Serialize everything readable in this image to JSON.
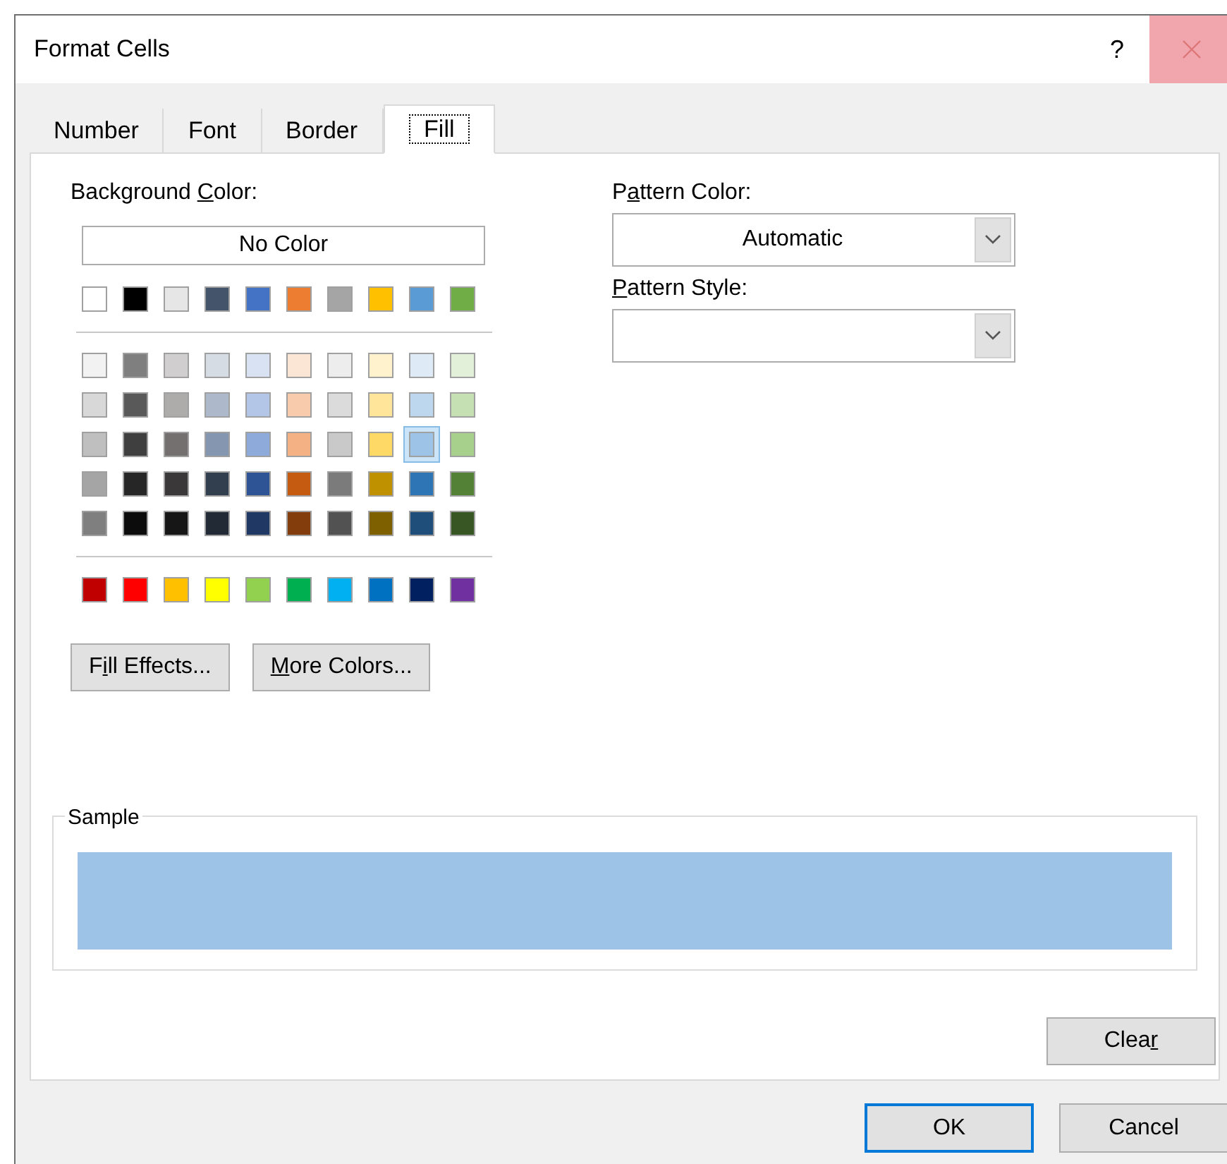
{
  "window": {
    "title": "Format Cells",
    "help": "?"
  },
  "tabs": [
    {
      "label": "Number",
      "selected": false
    },
    {
      "label": "Font",
      "selected": false
    },
    {
      "label": "Border",
      "selected": false
    },
    {
      "label": "Fill",
      "selected": true
    }
  ],
  "background_color": {
    "label": {
      "before": "Background ",
      "key": "C",
      "after": "olor:"
    },
    "no_color_button": "No Color",
    "theme_row": [
      {
        "color": "#ffffff",
        "selected": false
      },
      {
        "color": "#000000",
        "selected": false
      },
      {
        "color": "#e7e6e6",
        "selected": false
      },
      {
        "color": "#44546a",
        "selected": false
      },
      {
        "color": "#4472c4",
        "selected": false
      },
      {
        "color": "#ed7d31",
        "selected": false
      },
      {
        "color": "#a5a5a5",
        "selected": false
      },
      {
        "color": "#ffc000",
        "selected": false
      },
      {
        "color": "#5b9bd5",
        "selected": false
      },
      {
        "color": "#70ad47",
        "selected": false
      }
    ],
    "shade_rows": [
      [
        {
          "color": "#f2f2f2",
          "selected": false
        },
        {
          "color": "#7f7f7f",
          "selected": false
        },
        {
          "color": "#d0cece",
          "selected": false
        },
        {
          "color": "#d6dce4",
          "selected": false
        },
        {
          "color": "#d9e2f3",
          "selected": false
        },
        {
          "color": "#fbe5d5",
          "selected": false
        },
        {
          "color": "#ededed",
          "selected": false
        },
        {
          "color": "#fff2cc",
          "selected": false
        },
        {
          "color": "#deebf6",
          "selected": false
        },
        {
          "color": "#e2efd9",
          "selected": false
        }
      ],
      [
        {
          "color": "#d8d8d8",
          "selected": false
        },
        {
          "color": "#595959",
          "selected": false
        },
        {
          "color": "#aeabab",
          "selected": false
        },
        {
          "color": "#adb9ca",
          "selected": false
        },
        {
          "color": "#b4c6e7",
          "selected": false
        },
        {
          "color": "#f7cbac",
          "selected": false
        },
        {
          "color": "#dbdbdb",
          "selected": false
        },
        {
          "color": "#fee599",
          "selected": false
        },
        {
          "color": "#bdd7ee",
          "selected": false
        },
        {
          "color": "#c5e0b3",
          "selected": false
        }
      ],
      [
        {
          "color": "#bfbfbf",
          "selected": false
        },
        {
          "color": "#3f3f3f",
          "selected": false
        },
        {
          "color": "#757070",
          "selected": false
        },
        {
          "color": "#8496b0",
          "selected": false
        },
        {
          "color": "#8eaadb",
          "selected": false
        },
        {
          "color": "#f4b183",
          "selected": false
        },
        {
          "color": "#c9c9c9",
          "selected": false
        },
        {
          "color": "#ffd965",
          "selected": false
        },
        {
          "color": "#9dc3e6",
          "selected": true
        },
        {
          "color": "#a8d08d",
          "selected": false
        }
      ],
      [
        {
          "color": "#a5a5a5",
          "selected": false
        },
        {
          "color": "#262626",
          "selected": false
        },
        {
          "color": "#3a3838",
          "selected": false
        },
        {
          "color": "#323f4f",
          "selected": false
        },
        {
          "color": "#2f5496",
          "selected": false
        },
        {
          "color": "#c55a11",
          "selected": false
        },
        {
          "color": "#7b7b7b",
          "selected": false
        },
        {
          "color": "#bf9000",
          "selected": false
        },
        {
          "color": "#2e75b5",
          "selected": false
        },
        {
          "color": "#538135",
          "selected": false
        }
      ],
      [
        {
          "color": "#7f7f7f",
          "selected": false
        },
        {
          "color": "#0c0c0c",
          "selected": false
        },
        {
          "color": "#171616",
          "selected": false
        },
        {
          "color": "#222a35",
          "selected": false
        },
        {
          "color": "#1f3864",
          "selected": false
        },
        {
          "color": "#833c0b",
          "selected": false
        },
        {
          "color": "#525252",
          "selected": false
        },
        {
          "color": "#7f6000",
          "selected": false
        },
        {
          "color": "#1e4e79",
          "selected": false
        },
        {
          "color": "#375623",
          "selected": false
        }
      ]
    ],
    "standard_row": [
      {
        "color": "#c00000",
        "selected": false
      },
      {
        "color": "#ff0000",
        "selected": false
      },
      {
        "color": "#ffc000",
        "selected": false
      },
      {
        "color": "#ffff00",
        "selected": false
      },
      {
        "color": "#92d050",
        "selected": false
      },
      {
        "color": "#00b050",
        "selected": false
      },
      {
        "color": "#00b0f0",
        "selected": false
      },
      {
        "color": "#0070c0",
        "selected": false
      },
      {
        "color": "#002060",
        "selected": false
      },
      {
        "color": "#7030a0",
        "selected": false
      }
    ],
    "buttons": [
      {
        "before": "F",
        "key": "i",
        "after": "ll Effects..."
      },
      {
        "key": "M",
        "after": "ore Colors..."
      }
    ]
  },
  "pattern_color": {
    "label": {
      "before": "P",
      "key": "a",
      "after": "ttern Color:"
    },
    "value": "Automatic"
  },
  "pattern_style": {
    "label": {
      "key": "P",
      "after": "attern Style:"
    }
  },
  "sample": {
    "label": "Sample"
  },
  "clear_button": {
    "before": "Clea",
    "key": "r"
  },
  "footer_buttons": [
    {
      "label": "OK",
      "default": true
    },
    {
      "label": "Cancel",
      "default": false
    }
  ]
}
